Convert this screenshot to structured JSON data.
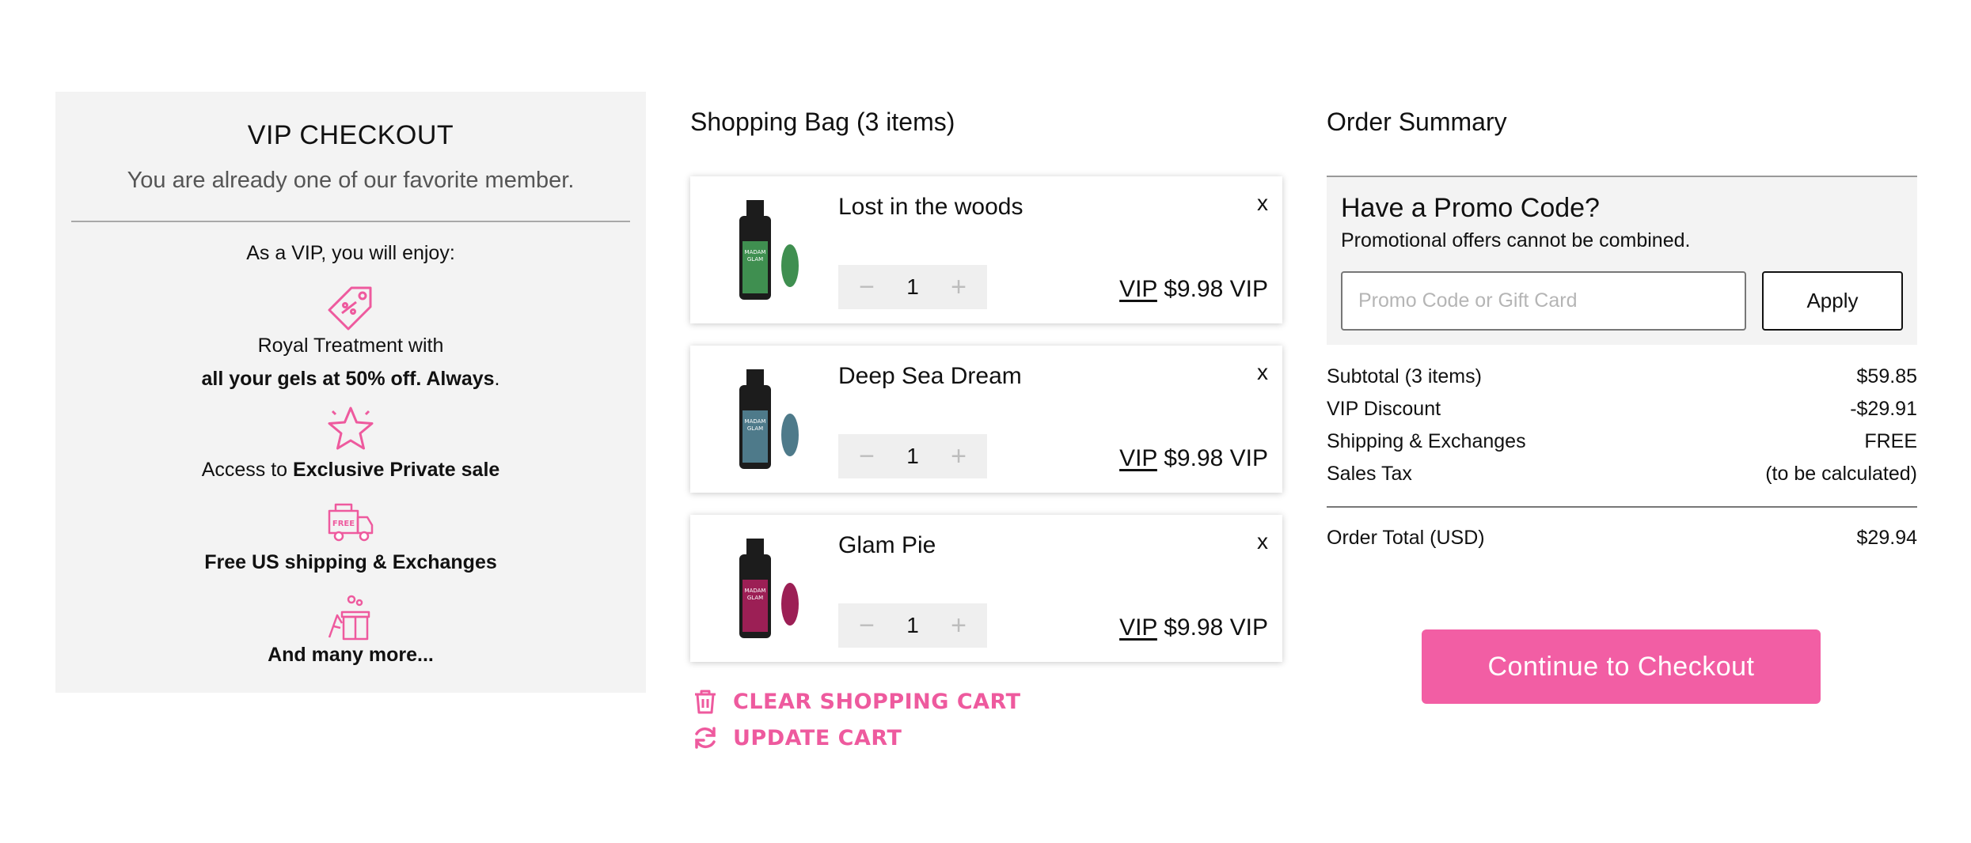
{
  "vip": {
    "title": "VIP CHECKOUT",
    "subtitle": "You are already one of our favorite member.",
    "enjoy": "As a VIP, you will enjoy:",
    "perks": [
      {
        "icon": "price-tag-icon",
        "line1": "Royal Treatment with",
        "line2_bold": "all your gels at 50% off. Always",
        "line2_tail": "."
      },
      {
        "icon": "star-icon",
        "prefix": "Access to ",
        "bold": "Exclusive Private sale"
      },
      {
        "icon": "free-shipping-truck-icon",
        "icon_text": "FREE",
        "bold": "Free US shipping & Exchanges"
      },
      {
        "icon": "gift-icon",
        "bold": "And many more..."
      }
    ]
  },
  "bag": {
    "title": "Shopping Bag (3 items)",
    "items": [
      {
        "name": "Lost in the woods",
        "qty": "1",
        "price_prefix": "VIP",
        "price": "$9.98 VIP",
        "color": "#3f8f50",
        "remove": "x",
        "brand": "MADAM GLAM"
      },
      {
        "name": "Deep Sea Dream",
        "qty": "1",
        "price_prefix": "VIP",
        "price": "$9.98 VIP",
        "color": "#4e7a8a",
        "remove": "x",
        "brand": "MADAM GLAM"
      },
      {
        "name": "Glam Pie",
        "qty": "1",
        "price_prefix": "VIP",
        "price": "$9.98 VIP",
        "color": "#9c1f55",
        "remove": "x",
        "brand": "MADAM GLAM"
      }
    ],
    "qty_minus": "−",
    "qty_plus": "+",
    "clear_label": "CLEAR SHOPPING CART",
    "update_label": "UPDATE CART"
  },
  "summary": {
    "title": "Order Summary",
    "promo_heading": "Have a Promo Code?",
    "promo_note": "Promotional offers cannot be combined.",
    "promo_placeholder": "Promo Code or Gift Card",
    "apply_label": "Apply",
    "rows": [
      {
        "label": "Subtotal (3 items)",
        "value": "$59.85"
      },
      {
        "label": "VIP Discount",
        "value": "-$29.91"
      },
      {
        "label": "Shipping & Exchanges",
        "value": "FREE"
      },
      {
        "label": "Sales Tax",
        "value": "(to be calculated)"
      }
    ],
    "total_label": "Order Total (USD)",
    "total_value": "$29.94",
    "checkout_label": "Continue to Checkout"
  },
  "colors": {
    "accent_pink": "#ee5a9e",
    "checkout_pink": "#f25ea4",
    "panel_gray": "#f3f3f3"
  }
}
